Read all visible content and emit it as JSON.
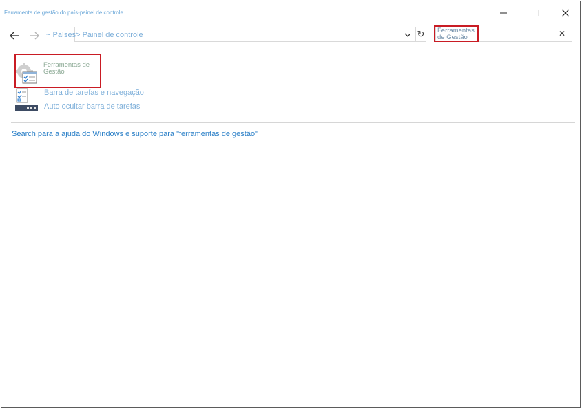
{
  "window": {
    "title": "Ferramenta de gestão do país-painel de controle"
  },
  "navigation": {
    "breadcrumb_1": "~ Países",
    "breadcrumb_2": "> Painel de controle"
  },
  "search": {
    "value": "Ferramentas de Gestão"
  },
  "results": {
    "main_title": "Ferramentas de Gestão",
    "tasks": [
      {
        "label": "Barra de tarefas e navegação"
      },
      {
        "label": "Auto ocultar barra de tarefas"
      }
    ]
  },
  "help": {
    "link": "Search para a ajuda do Windows e suporte para \"ferramentas de gestão\""
  },
  "icons": {
    "back": "back-arrow-icon",
    "forward": "forward-arrow-icon",
    "refresh": "refresh-icon",
    "clear": "close-icon",
    "admin_tools": "administrative-tools-icon",
    "taskbar": "taskbar-icon"
  },
  "colors": {
    "highlight": "#c91c24",
    "link": "#2a7fc7"
  }
}
